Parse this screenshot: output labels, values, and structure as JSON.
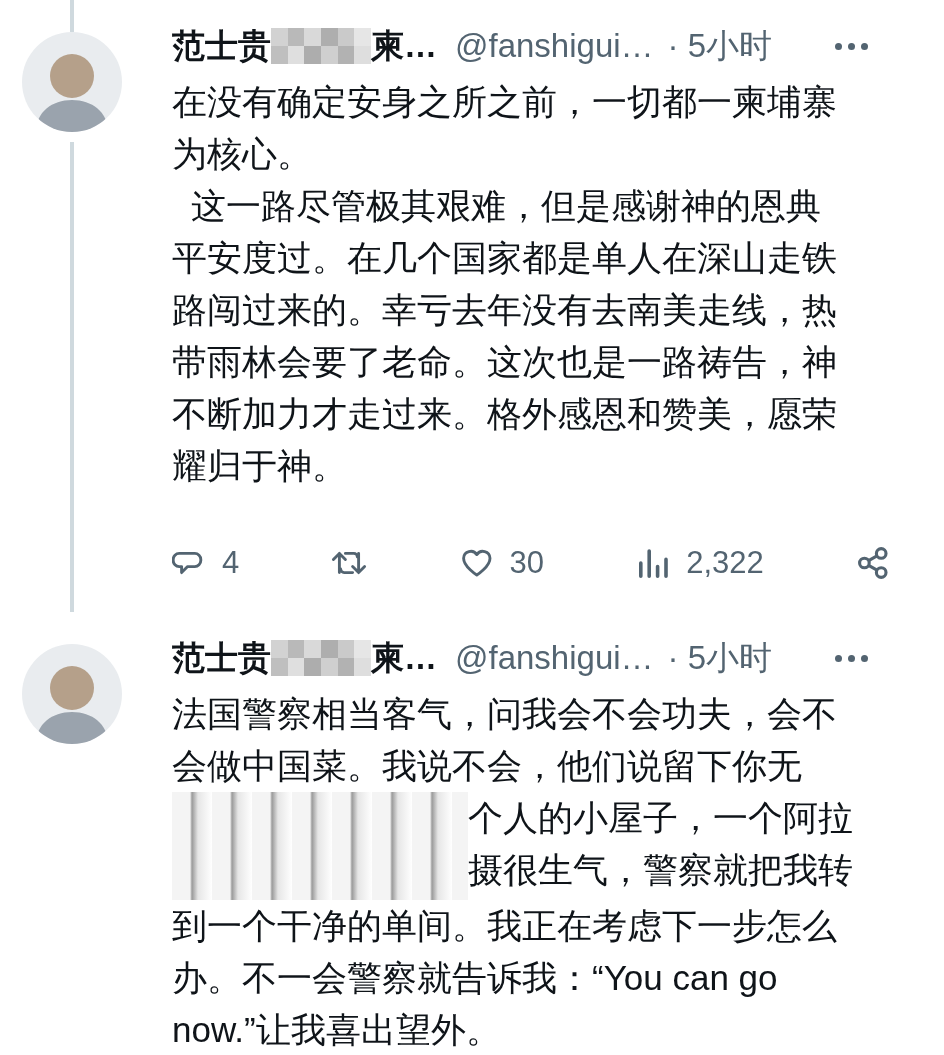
{
  "tweets": [
    {
      "name_start": "范士贵",
      "name_end": "柬…",
      "handle": "@fanshigui…",
      "time": "· 5小时",
      "thread_above": true,
      "thread_below": true,
      "body": [
        {
          "kind": "text",
          "text": "在没有确定安身之所之前，一切都一柬埔寨为核心。"
        },
        {
          "kind": "text",
          "text": "  这一路尽管极其艰难，但是感谢神的恩典平安度过。在几个国家都是单人在深山走铁路闯过来的。幸亏去年没有去南美走线，热带雨林会要了老命。这次也是一路祷告，神不断加力才走过来。格外感恩和赞美，愿荣耀归于神。"
        }
      ],
      "actions": {
        "replies": "4",
        "likes": "30",
        "views": "2,322"
      }
    },
    {
      "name_start": "范士贵",
      "name_end": "柬…",
      "handle": "@fanshigui…",
      "time": "· 5小时",
      "body": [
        {
          "kind": "text",
          "text": "法国警察相当客气，问我会不会功夫，会不会做中国菜。我说不会，他们说留下你无"
        },
        {
          "kind": "beside_redaction",
          "lines": [
            "个人的小屋子，一个阿拉",
            "摄很生气，警察就把我转"
          ]
        },
        {
          "kind": "text",
          "text": "到一个干净的单间。我正在考虑下一步怎么办。不一会警察就告诉我：“You can go now.”让我喜出望外。"
        }
      ]
    }
  ]
}
